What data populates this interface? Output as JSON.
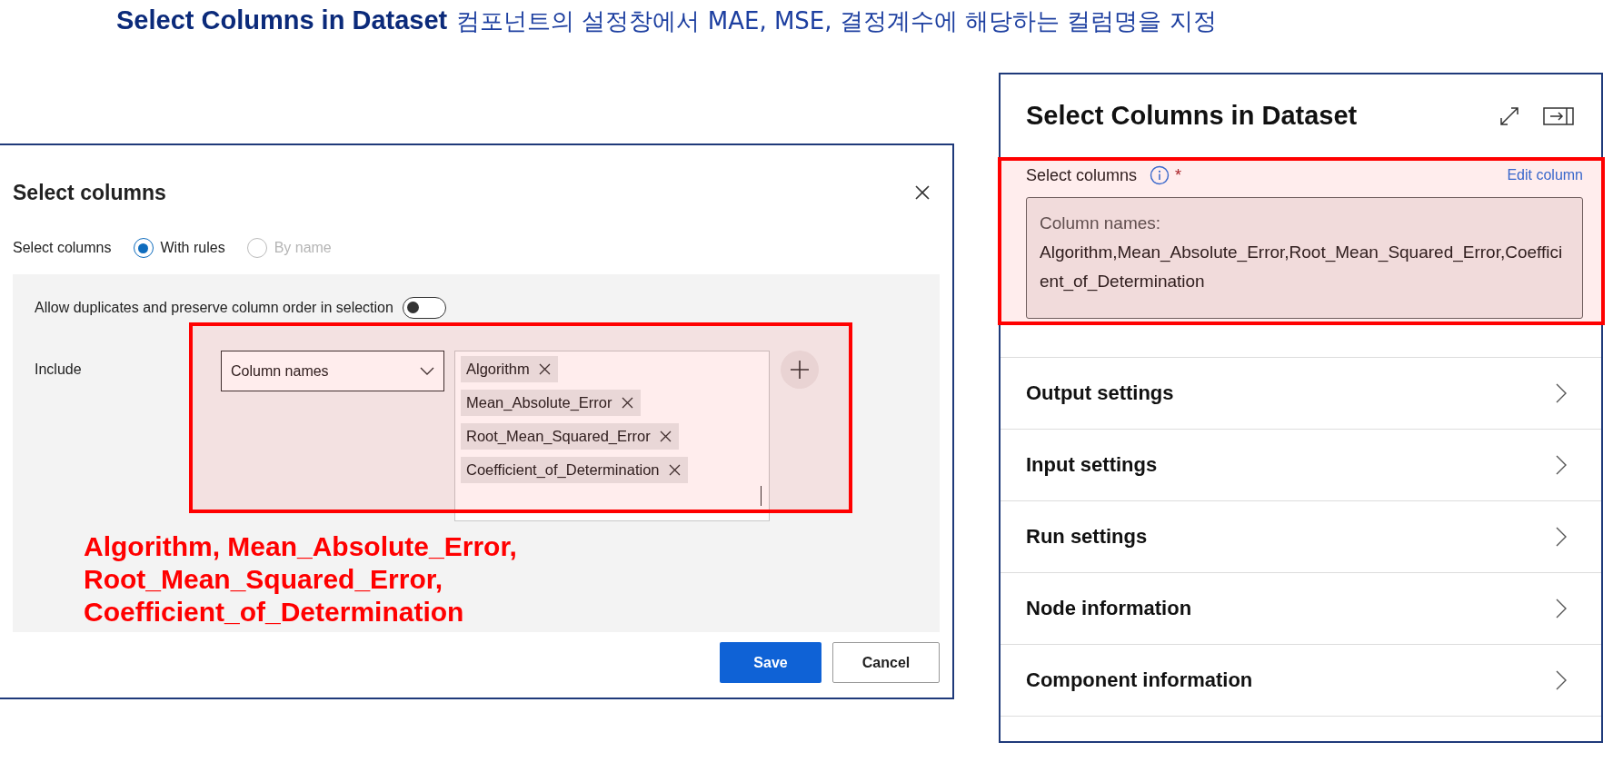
{
  "heading": {
    "title": "Select Columns in Dataset",
    "description": "컴포넌트의 설정창에서 MAE, MSE, 결정계수에 해당하는 컬럼명을 지정"
  },
  "dialog": {
    "title": "Select columns",
    "select_label": "Select columns",
    "options": [
      {
        "label": "With rules",
        "selected": true,
        "disabled": false
      },
      {
        "label": "By name",
        "selected": false,
        "disabled": true
      }
    ],
    "toggle": {
      "label": "Allow duplicates and preserve column order in selection",
      "on": false
    },
    "include": {
      "label": "Include",
      "dropdown": "Column names",
      "tags": [
        "Algorithm",
        "Mean_Absolute_Error",
        "Root_Mean_Squared_Error",
        "Coefficient_of_Determination"
      ]
    },
    "annotation": [
      "Algorithm, Mean_Absolute_Error,",
      "Root_Mean_Squared_Error,",
      "Coefficient_of_Determination"
    ],
    "buttons": [
      {
        "label": "Save",
        "kind": "primary"
      },
      {
        "label": "Cancel",
        "kind": "secondary"
      }
    ]
  },
  "panel": {
    "title": "Select Columns in Dataset",
    "field": {
      "label": "Select columns",
      "required": "*",
      "link": "Edit column",
      "value_label": "Column names:",
      "value": "Algorithm,Mean_Absolute_Error,Root_Mean_Squared_Error,Coefficient_of_Determination"
    },
    "sections": [
      "Output settings",
      "Input settings",
      "Run settings",
      "Node information",
      "Component information"
    ]
  }
}
